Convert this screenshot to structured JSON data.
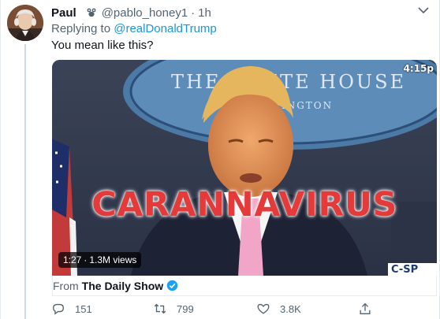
{
  "tweet": {
    "author_name": "Paul",
    "author_handle": "@pablo_honey1",
    "dot": "·",
    "time": "1h",
    "replying_prefix": "Replying to",
    "replying_to": "@realDonaldTrump",
    "text": "You mean like this?"
  },
  "media": {
    "timestamp": "4:15p",
    "backdrop_sign": "THE WHITE HOUSE",
    "backdrop_sign_sub": "WASHINGTON",
    "caption": "CARANNAVIRUS",
    "duration": "1:27",
    "views": "1.3M views",
    "network_logo": "C-SP"
  },
  "source": {
    "from_label": "From",
    "name": "The Daily Show",
    "verified": true
  },
  "actions": {
    "reply_count": "151",
    "retweet_count": "799",
    "like_count": "3.8K"
  },
  "colors": {
    "link_blue": "#1b95e0",
    "caption_red": "#e53a3a",
    "muted_gray": "#536471",
    "verified_blue": "#1da1f2"
  },
  "icons": {
    "handle": "face-emoji-icon",
    "reply": "reply-icon",
    "retweet": "retweet-icon",
    "like": "heart-icon",
    "share": "share-icon",
    "verified": "verified-badge-icon",
    "more": "more-options-icon"
  }
}
